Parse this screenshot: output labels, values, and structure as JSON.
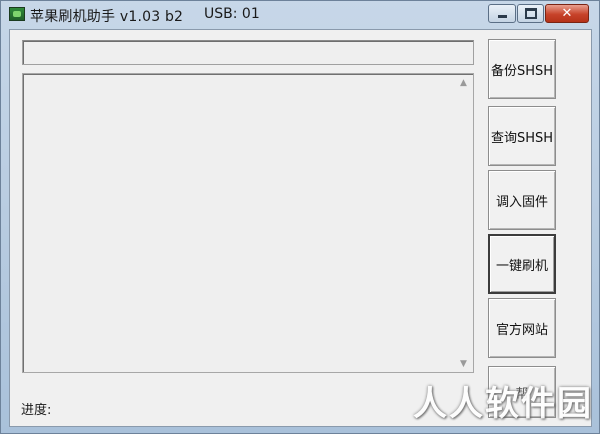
{
  "window": {
    "title": "苹果刷机助手 v1.03 b2",
    "usb_status": "USB:  01",
    "controls": {
      "minimize_icon": "minimize-icon",
      "maximize_icon": "maximize-icon",
      "close_icon": "close-icon",
      "close_glyph": "✕"
    }
  },
  "main": {
    "status_value": "",
    "log_text": "",
    "progress_label": "进度:"
  },
  "buttons": [
    {
      "label": "备份SHSH"
    },
    {
      "label": "查询SHSH"
    },
    {
      "label": "调入固件"
    },
    {
      "label": "一键刷机"
    },
    {
      "label": "官方网站"
    },
    {
      "label": "帮"
    }
  ],
  "overlay": {
    "watermark": "人人软件园"
  },
  "colors": {
    "titlebar": "#b8cde2",
    "client_bg": "#f0f0f0",
    "close_button": "#c7432a"
  }
}
